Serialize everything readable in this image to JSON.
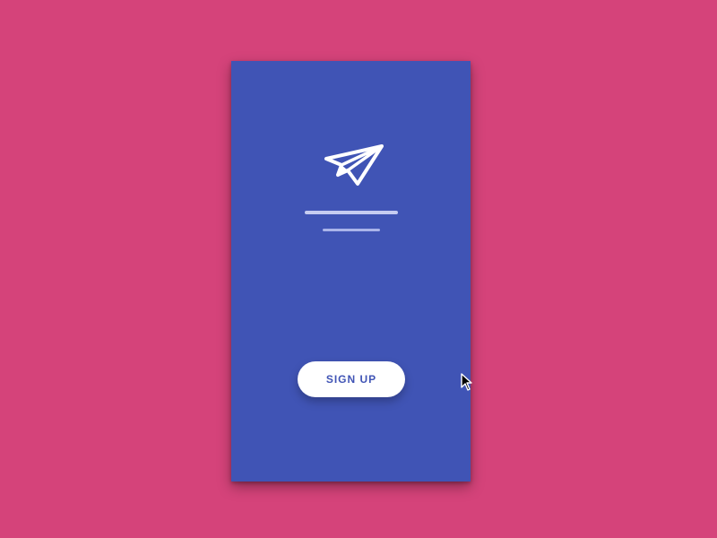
{
  "background_color": "#d5437a",
  "screen": {
    "background_color": "#4054b5",
    "logo_icon": "paper-plane-icon",
    "signup_button": {
      "label": "SIGN UP",
      "text_color": "#4054b5",
      "background_color": "#ffffff"
    }
  },
  "cursor_icon": "mouse-pointer-icon"
}
